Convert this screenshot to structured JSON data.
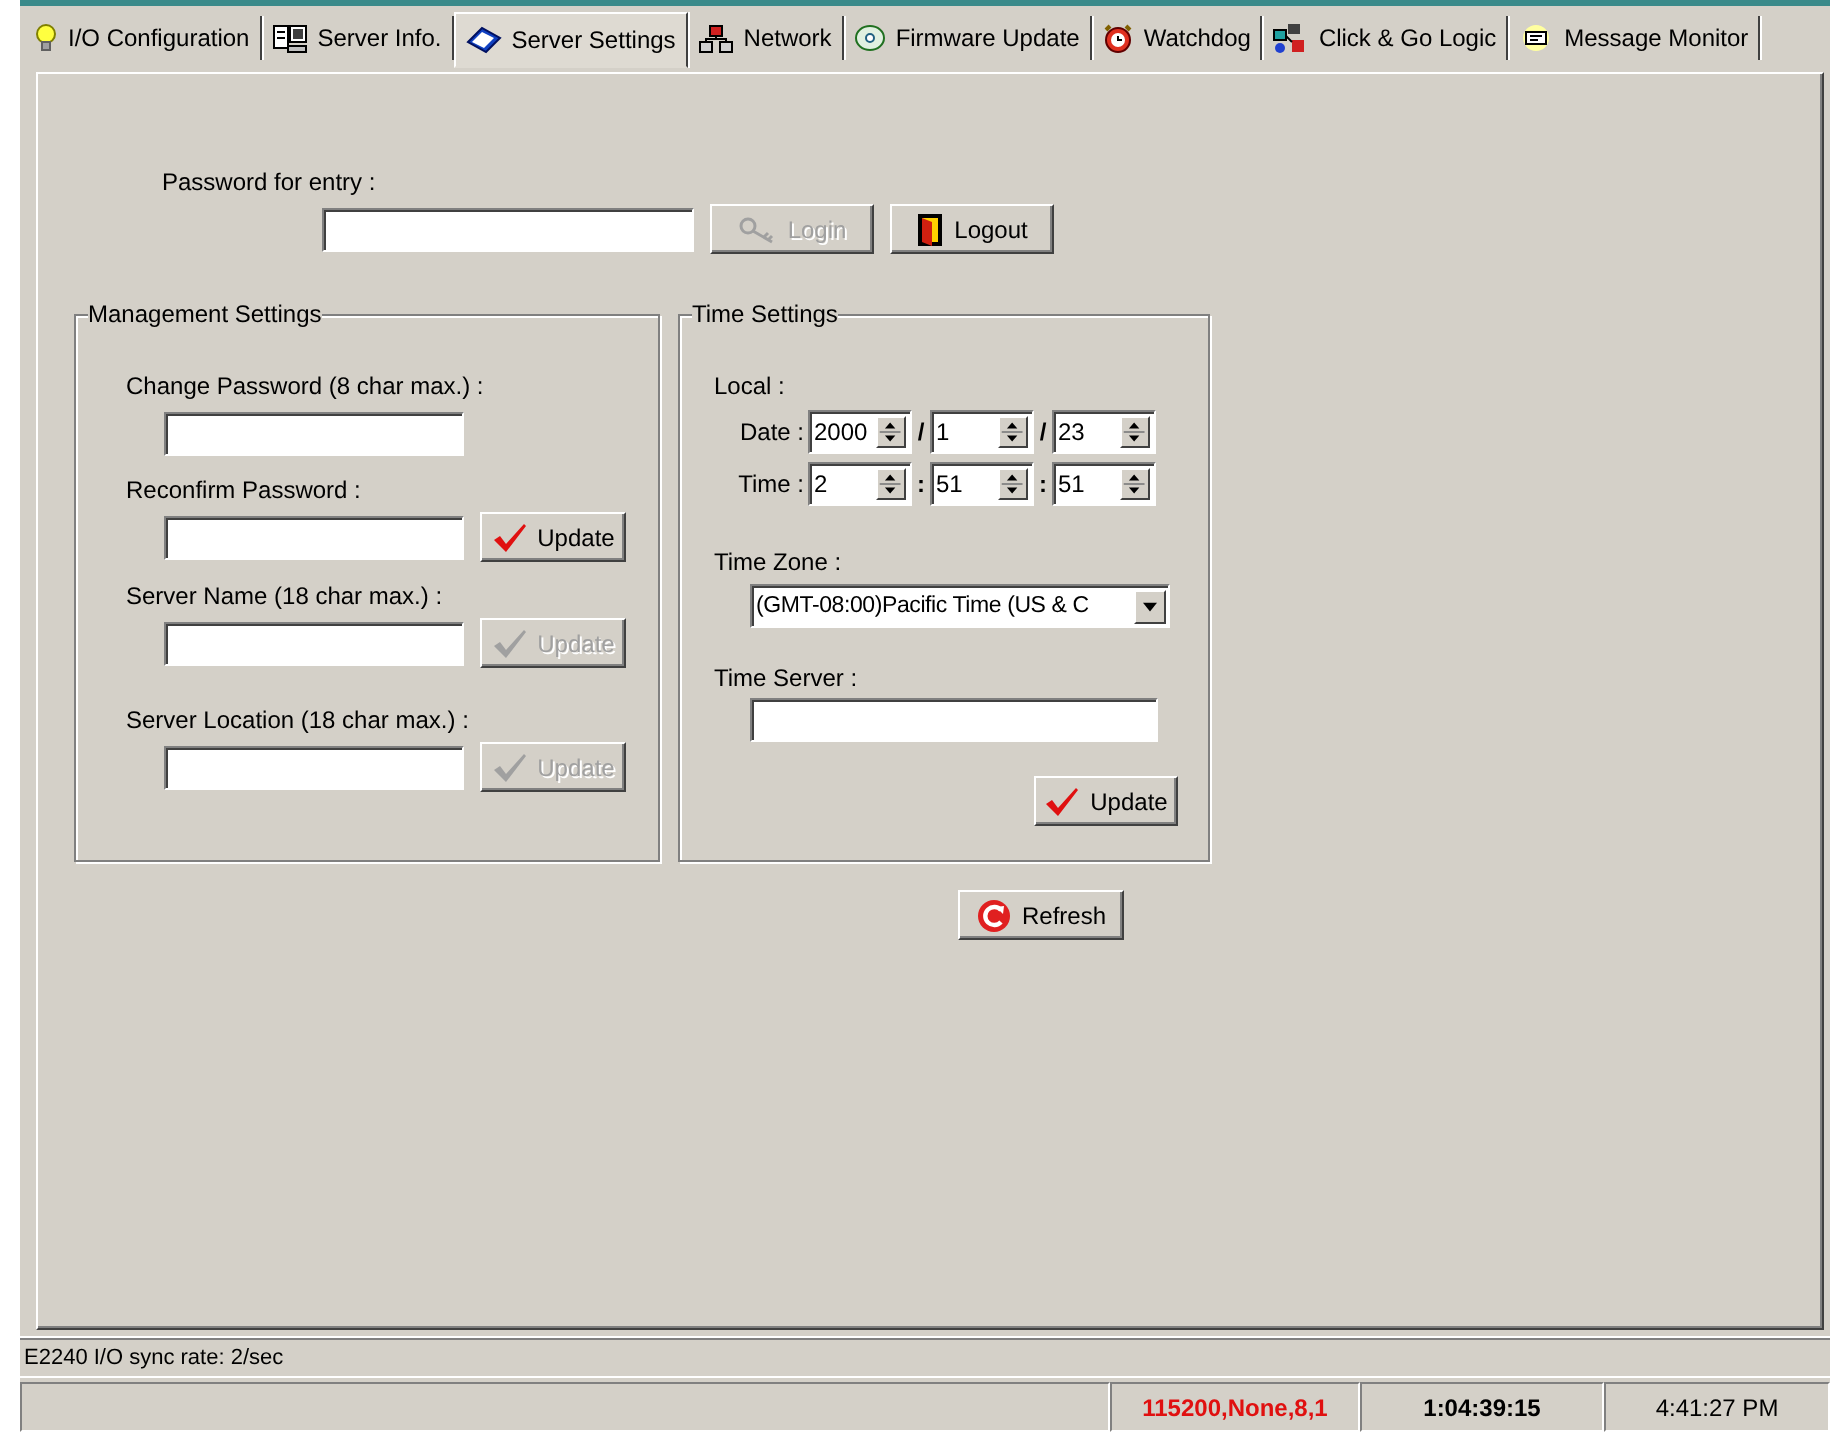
{
  "tabs": [
    {
      "label": "I/O Configuration",
      "selected": false
    },
    {
      "label": "Server Info.",
      "selected": false
    },
    {
      "label": "Server Settings",
      "selected": true
    },
    {
      "label": "Network",
      "selected": false
    },
    {
      "label": "Firmware Update",
      "selected": false
    },
    {
      "label": "Watchdog",
      "selected": false
    },
    {
      "label": "Click & Go Logic",
      "selected": false
    },
    {
      "label": "Message Monitor",
      "selected": false
    }
  ],
  "entry": {
    "label": "Password for entry :",
    "login_button": {
      "label": "Login",
      "disabled": true
    },
    "logout_button": {
      "label": "Logout",
      "disabled": false
    }
  },
  "management": {
    "title": "Management Settings",
    "fields": [
      {
        "label": "Change Password (8 char max.) :"
      },
      {
        "label": "Reconfirm Password :",
        "button": {
          "label": "Update",
          "disabled": false
        }
      },
      {
        "label": "Server Name (18 char max.) :",
        "button": {
          "label": "Update",
          "disabled": true
        }
      },
      {
        "label": "Server Location (18 char max.) :",
        "button": {
          "label": "Update",
          "disabled": true
        }
      }
    ]
  },
  "time_settings": {
    "title": "Time Settings",
    "local_label": "Local :",
    "date": {
      "label": "Date :",
      "values": [
        "2000",
        "1",
        "23"
      ],
      "separators": [
        "/",
        "/"
      ]
    },
    "time": {
      "label": "Time :",
      "values": [
        "2",
        "51",
        "51"
      ],
      "separators": [
        ":",
        ":"
      ]
    },
    "time_zone": {
      "label": "Time Zone :",
      "value": "(GMT-08:00)Pacific Time (US & C"
    },
    "time_server": {
      "label": "Time Server :"
    },
    "update_button": {
      "label": "Update",
      "disabled": false
    }
  },
  "refresh_button": {
    "label": "Refresh",
    "disabled": false
  },
  "status_line": "E2240 I/O sync rate: 2/sec",
  "status_bar": {
    "connection": "115200,None,8,1",
    "elapsed": "1:04:39:15",
    "clock": "4:41:27 PM"
  }
}
